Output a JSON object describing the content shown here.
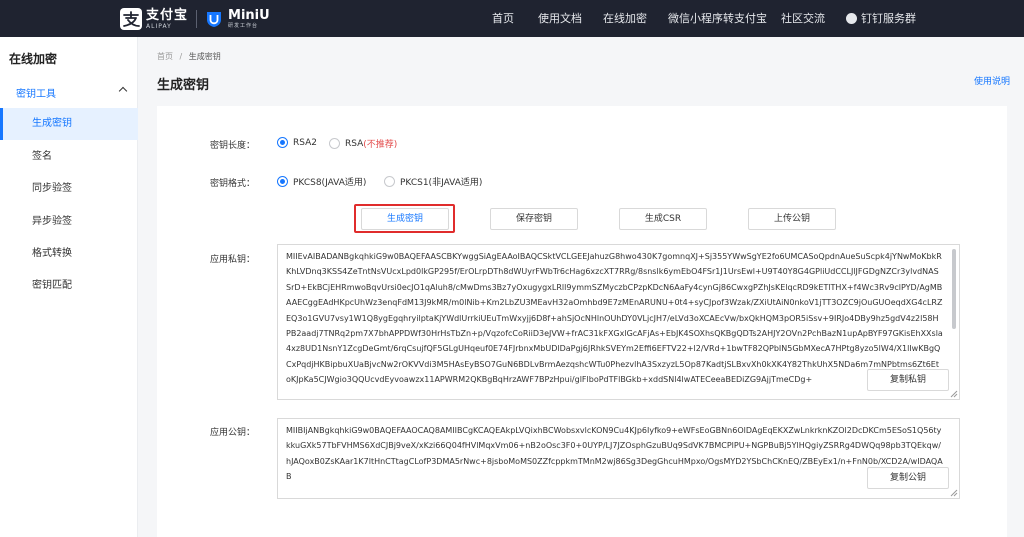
{
  "brand": {
    "alipay_name": "支付宝",
    "alipay_sub": "ALIPAY",
    "miniu_name": "MiniU",
    "miniu_sub": "研发工作台"
  },
  "topnav": {
    "items": [
      "首页",
      "使用文档",
      "在线加密",
      "微信小程序转支付宝",
      "社区交流",
      "钉钉服务群"
    ]
  },
  "sidebar": {
    "title": "在线加密",
    "group": "密钥工具",
    "items": [
      "生成密钥",
      "签名",
      "同步验签",
      "异步验签",
      "格式转换",
      "密钥匹配"
    ],
    "active_index": 0
  },
  "header": {
    "breadcrumb_home": "首页",
    "breadcrumb_sep": "/",
    "breadcrumb_current": "生成密钥",
    "title": "生成密钥",
    "help": "使用说明"
  },
  "form": {
    "key_length_label": "密钥长度：",
    "key_length_options": [
      "RSA2",
      "RSA"
    ],
    "key_length_warn": "(不推荐)",
    "key_length_selected": "RSA2",
    "key_format_label": "密钥格式：",
    "key_format_options": [
      "PKCS8(JAVA适用)",
      "PKCS1(非JAVA适用)"
    ],
    "key_format_selected": "PKCS8(JAVA适用)",
    "buttons": [
      "生成密钥",
      "保存密钥",
      "生成CSR",
      "上传公钥"
    ],
    "private_key_label": "应用私钥：",
    "private_key": "MIIEvAIBADANBgkqhkiG9w0BAQEFAASCBKYwggSiAgEAAoIBAQCSktVCLGEEJahuzG8hwo430K7gomnqXJ+Sj355YWwSgYE2fo6UMCASoQpdnAueSuScpk4jYNwMoKbkRKhLVDnq3KSS4ZeTntNsVUcxLpd0lkGP295f/ErOLrpDTh8dWUyrFWbTr6cHag6xzcXT7RRg/8snslk6ymEbO4FSr1J1UrsEwl+U9T40Y8G4GPliUdCCLJlJFGDgNZCr3ylvdNASSrD+EkBCjEHRmwoBqvUrsi0ecJO1qAluh8/cMwDms3Bz7yOxugygxLRll9ymmSZMyczbCPzpKDcN6AaFy4cynGj86CwxgPZhJsKElqcRD9kETlTHX+f4Wc3Rv9clPYD/AgMBAAECggEAdHKpcUhWz3enqFdM13J9kMR/m0lNib+Km2LbZU3MEavH32aOmhbd9E7zMEnARUNU+0t4+syCJpof3Wzak/ZXiUtAiN0nkoV1jTT3OZC9jOuGUOeqdXG4cLRZEQ3o1GVU7vsy1W1Q8ygEgqhryilptaKjYWdlUrrkiUEuTmWxyjj6D8f+ahSjOcNHlnOUhDY0VLjcJH7/eLVd3oXCAEcVw/bxQkHQM3pOR5iSsv+9IRJo4DBy9hz5gdV4z2l58HPB2aadj7TNRq2pm7X7bhAPPDWf30HrHsTbZn+p/VqzofcCoRiiD3eJVW+frAC31kFXGxlGcAFjAs+EbJK4SOXhsQKBgQDTs2AHJY2OVn2PchBazN1upApBYF97GKisEhXXsla4xz8UD1NsnY1ZcgDeGmt/6rqCsujfQF5GLgUHqeuf0E74FJrbnxMbUDlDaPgj6JRhkSVEYm2Effi6EFTV22+l2/VRd+1bwTF82QPbIN5GbMXecA7HPtg8yzo5lW4/X1lIwKBgQCxPqdjHKBipbuXUaBjvcNw2rOKVVdi3M5HAsEyBSO7GuN6BDLvBrmAezqshcWTu0PhezvlhA3SxzyzL5Op87KadtjSLBxvXh0kXK4Y82ThkUhX5NDa6m7mNPbtms6Zt6EtoKJpKa5CJWgio3QQUcvdEyvoawzx11APWRM2QKBgBqHrzAWF7BPzHpui/glFlboPdTFlBGkb+xddSNl4lwATECeeaBEDiZG9AjjTmeCDg+",
    "copy_private": "复制私钥",
    "public_key_label": "应用公钥：",
    "public_key": "MIIBIjANBgkqhkiG9w0BAQEFAAOCAQ8AMIIBCgKCAQEAkpLVQixhBCWobsxvlcKON9Cu4KJp6Iyfko9+eWFsEoGBNn6OlDAgEqEKXZwLnkrknKZOl2DcDKCm5ESoS1Q56tykkuGXk57TbFVHMS6XdCJBj9veX/xKzi66Q04fHVlMqxVm06+nB2oOsc3F0+0UYP/LJ7JZOsphGzuBUq9SdVK7BMCPlPU+NGPBuBj5YlHQgiyZSRRg4DWQq98pb3TQEkqw/hJAQoxB0ZsKAar1K7ltHnCTtagCLofP3DMA5rNwc+8jsboMoMS0ZZfcppkmTMnM2wj86Sg3DegGhcuHMpxo/OgsMYD2YSbChCKnEQ/ZBEyEx1/n+FnN0b/XCD2A/wIDAQAB",
    "copy_public": "复制公钥"
  },
  "colors": {
    "topbar": "#1f2330",
    "accent": "#1677ff",
    "highlight": "#e02c2c",
    "warn": "#e34b4b"
  }
}
